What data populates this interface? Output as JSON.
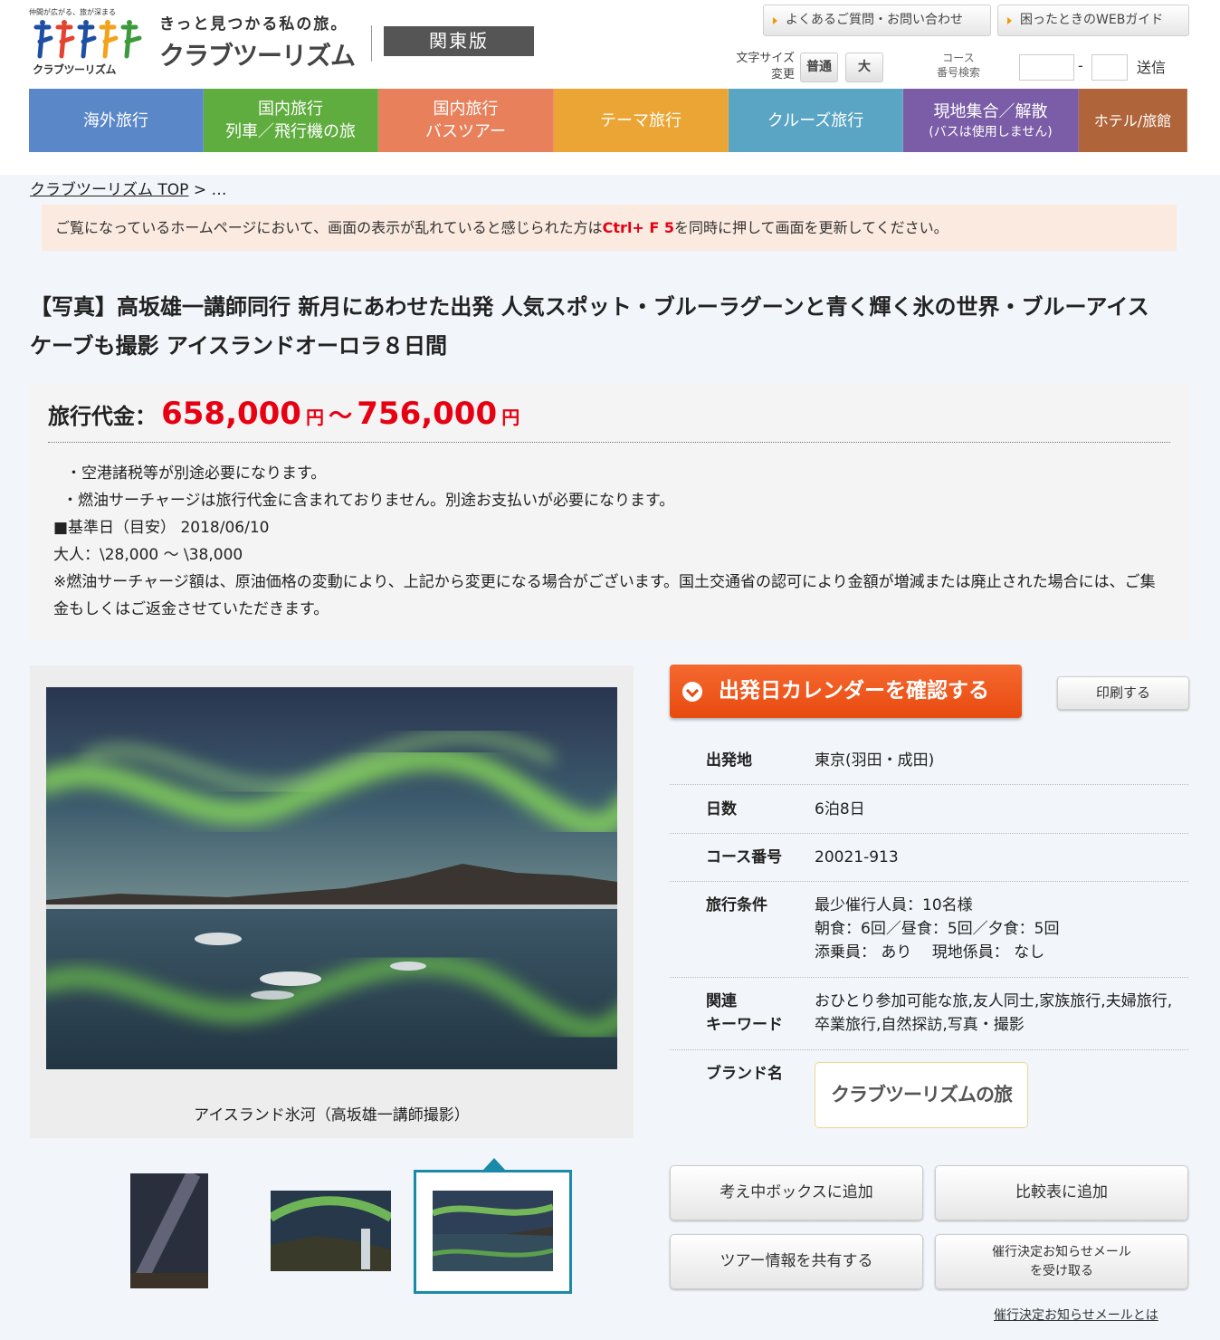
{
  "header": {
    "logo_tagline": "仲間が広がる、旅が深まる",
    "logo_small": "クラブツーリズム",
    "catchcopy": "きっと見つかる私の旅。",
    "brand_name": "クラブツーリズム",
    "region": "関東版",
    "faq_label": "よくあるご質問・お問い合わせ",
    "guide_label": "困ったときのWEBガイド",
    "fontsize_label_1": "文字サイズ",
    "fontsize_label_2": "変更",
    "fontsize_normal": "普通",
    "fontsize_large": "大",
    "course_search_1": "コース",
    "course_search_2": "番号検索",
    "course_dash": "-",
    "send_label": "送信"
  },
  "nav": [
    {
      "label": "海外旅行",
      "sub": "",
      "color": "#5a87c8"
    },
    {
      "label": "国内旅行",
      "sub": "列車／飛行機の旅",
      "color": "#5fad3e"
    },
    {
      "label": "国内旅行",
      "sub": "バスツアー",
      "color": "#e8805c"
    },
    {
      "label": "テーマ旅行",
      "sub": "",
      "color": "#eba534"
    },
    {
      "label": "クルーズ旅行",
      "sub": "",
      "color": "#5aa4c4"
    },
    {
      "label": "現地集合／解散",
      "sub": "(バスは使用しません)",
      "color": "#7a5da6"
    },
    {
      "label": "ホテル/旅館",
      "sub": "",
      "color": "#b0643a"
    }
  ],
  "breadcrumb": {
    "top": "クラブツーリズム TOP",
    "sep": " > …"
  },
  "notice": {
    "before": "ご覧になっているホームページにおいて、画面の表示が乱れていると感じられた方は",
    "highlight": "Ctrl+ F 5",
    "after": "を同時に押して画面を更新してください。"
  },
  "tour": {
    "title": "【写真】高坂雄一講師同行 新月にあわせた出発 人気スポット・ブルーラグーンと青く輝く氷の世界・ブルーアイスケーブも撮影 アイスランドオーロラ８日間"
  },
  "price": {
    "label": "旅行代金：",
    "min": "658,000",
    "yen": "円",
    "tilde": "～",
    "max": "756,000",
    "notes": [
      "・空港諸税等が別途必要になります。",
      "・燃油サーチャージは旅行代金に含まれておりません。別途お支払いが必要になります。",
      "■基準日（目安） 2018/06/10",
      "大人：\\28,000 ～ \\38,000",
      "※燃油サーチャージ額は、原油価格の変動により、上記から変更になる場合がございます。国土交通省の認可により金額が増減または廃止された場合には、ご集金もしくはご返金させていただきます。"
    ]
  },
  "photo": {
    "caption": "アイスランド氷河（高坂雄一講師撮影）"
  },
  "actions": {
    "calendar": "出発日カレンダーを確認する",
    "print": "印刷する",
    "consider": "考え中ボックスに追加",
    "compare": "比較表に追加",
    "share": "ツアー情報を共有する",
    "mail_1": "催行決定お知らせメール",
    "mail_2": "を受け取る",
    "mail_link": "催行決定お知らせメールとは"
  },
  "info": {
    "departure_label": "出発地",
    "departure": "東京(羽田・成田)",
    "days_label": "日数",
    "days": "6泊8日",
    "course_label": "コース番号",
    "course": "20021-913",
    "conditions_label": "旅行条件",
    "conditions": [
      "最少催行人員：10名様",
      "朝食：6回／昼食：5回／夕食：5回",
      "添乗員： あり　 現地係員： なし"
    ],
    "keywords_label_1": "関連",
    "keywords_label_2": "キーワード",
    "keywords": "おひとり参加可能な旅,友人同士,家族旅行,夫婦旅行,卒業旅行,自然探訪,写真・撮影",
    "brand_label": "ブランド名",
    "brand_logo": "クラブツーリズムの旅"
  }
}
